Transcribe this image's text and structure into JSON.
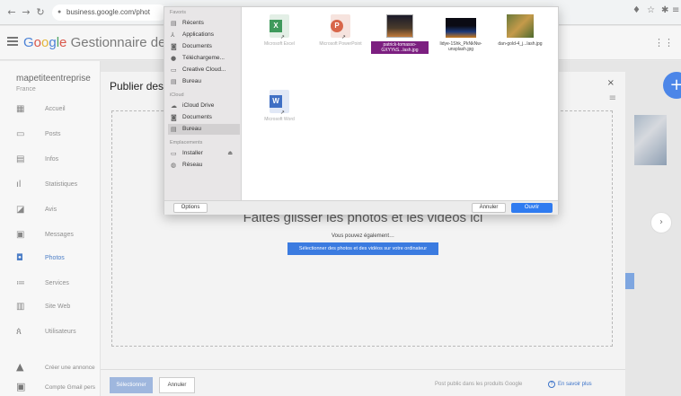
{
  "browser": {
    "url": "business.google.com/phot",
    "back_icon": "arrow-left-icon",
    "forward_icon": "arrow-right-icon",
    "reload_icon": "reload-icon"
  },
  "header": {
    "brand_google": [
      "G",
      "o",
      "o",
      "g",
      "l",
      "e"
    ],
    "brand_rest": "Gestionnaire de fic"
  },
  "sidebar": {
    "business_name": "mapetiteentreprise",
    "country": "France",
    "items": [
      {
        "label": "Accueil",
        "icon": "grid-icon"
      },
      {
        "label": "Posts",
        "icon": "post-icon"
      },
      {
        "label": "Infos",
        "icon": "store-icon"
      },
      {
        "label": "Statistiques",
        "icon": "stats-icon"
      },
      {
        "label": "Avis",
        "icon": "star-icon"
      },
      {
        "label": "Messages",
        "icon": "message-icon"
      },
      {
        "label": "Photos",
        "icon": "photo-icon"
      },
      {
        "label": "Services",
        "icon": "list-icon"
      },
      {
        "label": "Site Web",
        "icon": "web-icon"
      },
      {
        "label": "Utilisateurs",
        "icon": "users-icon"
      }
    ],
    "extra": [
      {
        "label": "Créer une annonce",
        "icon": "ads-icon"
      },
      {
        "label": "Compte Gmail pers",
        "icon": "mail-icon"
      }
    ]
  },
  "modal": {
    "title": "Publier des p",
    "drop_text": "Faites glisser les photos et les vidéos ici",
    "also_text": "Vous pouvez également…",
    "select_button": "Sélectionner des photos et des vidéos sur votre ordinateur",
    "publish_button": "Sélectionner",
    "cancel_button": "Annuler",
    "footer_note": "Post public dans les produits Google",
    "help_link": "En savoir plus"
  },
  "picker": {
    "sections": {
      "favorites": "Favoris",
      "icloud": "iCloud",
      "locations": "Emplacements"
    },
    "favorites": [
      {
        "label": "Récents",
        "icon": "clock-icon"
      },
      {
        "label": "Applications",
        "icon": "applications-icon"
      },
      {
        "label": "Documents",
        "icon": "document-icon"
      },
      {
        "label": "Téléchargeme...",
        "icon": "download-icon"
      },
      {
        "label": "Creative Cloud...",
        "icon": "folder-icon"
      },
      {
        "label": "Bureau",
        "icon": "desktop-icon"
      }
    ],
    "icloud": [
      {
        "label": "iCloud Drive",
        "icon": "cloud-icon"
      },
      {
        "label": "Documents",
        "icon": "document-icon"
      },
      {
        "label": "Bureau",
        "icon": "desktop-icon",
        "selected": true
      }
    ],
    "locations": [
      {
        "label": "Installer",
        "icon": "disk-icon"
      },
      {
        "label": "Réseau",
        "icon": "network-icon"
      }
    ],
    "files": [
      {
        "name": "Microsoft Excel",
        "kind": "excel"
      },
      {
        "name": "Microsoft PowerPoint",
        "kind": "powerpoint"
      },
      {
        "name": "patrick-tomasso-GXYYkS...lash.jpg",
        "kind": "photo",
        "selected": true
      },
      {
        "name": "lidye-1Shk_PkNkNw-unsplash.jpg",
        "kind": "photo2"
      },
      {
        "name": "dan-gold-4_j...lash.jpg",
        "kind": "photo3"
      },
      {
        "name": "Microsoft Word",
        "kind": "word"
      }
    ],
    "options_button": "Options",
    "cancel_button": "Annuler",
    "open_button": "Ouvrir"
  }
}
